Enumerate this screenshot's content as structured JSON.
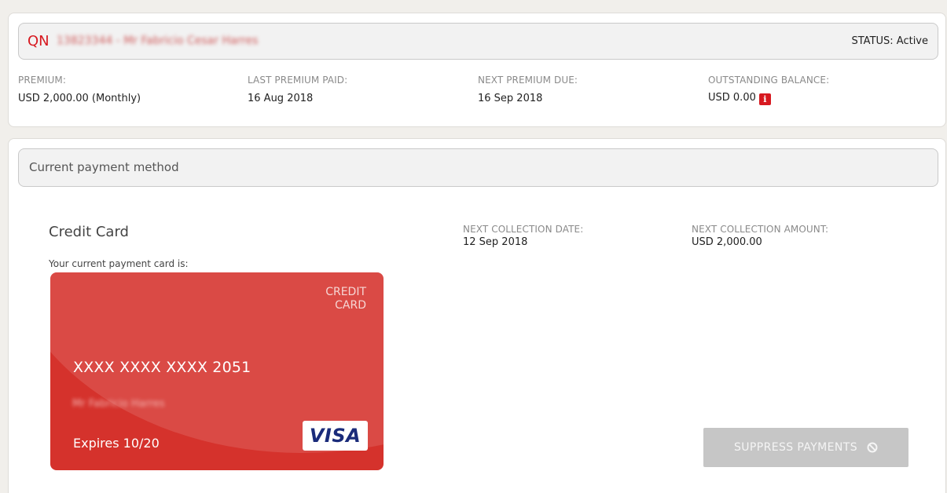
{
  "policy": {
    "number_prefix": "QN",
    "number_and_holder_redacted": "13823344 - Mr Fabricio Cesar Harres",
    "status": "STATUS: Active",
    "premium_label": "PREMIUM:",
    "premium_value": "USD 2,000.00 (Monthly)",
    "last_paid_label": "LAST PREMIUM PAID:",
    "last_paid_value": "16 Aug 2018",
    "next_due_label": "NEXT PREMIUM DUE:",
    "next_due_value": "16 Sep 2018",
    "outstanding_label": "OUTSTANDING BALANCE:",
    "outstanding_value": "USD 0.00",
    "info_icon_glyph": "i"
  },
  "payment": {
    "bar_title": "Current payment method",
    "method_title": "Credit Card",
    "card_intro": "Your current payment card is:",
    "next_collection_date_label": "NEXT COLLECTION DATE:",
    "next_collection_date_value": "12 Sep 2018",
    "next_collection_amount_label": "NEXT COLLECTION AMOUNT:",
    "next_collection_amount_value": "USD 2,000.00",
    "card": {
      "type_line1": "CREDIT",
      "type_line2": "CARD",
      "number": "XXXX XXXX XXXX 2051",
      "holder_redacted": "Mr Fabricio Harres",
      "expires": "Expires 10/20",
      "brand": "VISA",
      "color": "#d5322c"
    },
    "suppress_label": "SUPPRESS PAYMENTS",
    "suppress_icon": "ban-icon"
  },
  "colors": {
    "accent_red": "#d71920",
    "page_bg": "#f1efeb",
    "button_disabled": "#c6c6c6"
  }
}
